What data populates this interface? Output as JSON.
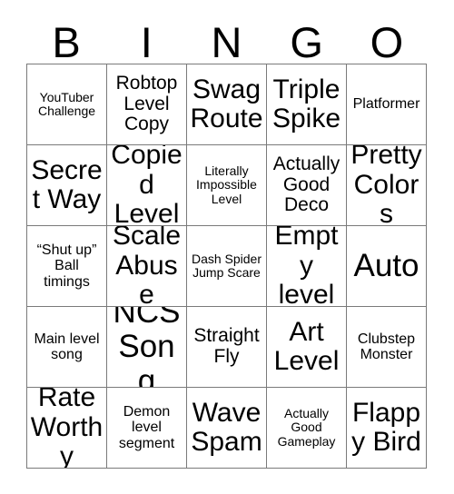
{
  "card": {
    "header_letters": [
      "B",
      "I",
      "N",
      "G",
      "O"
    ],
    "rows": [
      [
        {
          "text": "YouTuber Challenge",
          "size": "xs"
        },
        {
          "text": "Robtop Level Copy",
          "size": "md"
        },
        {
          "text": "Swag Route",
          "size": "xl"
        },
        {
          "text": "Triple Spike",
          "size": "xl"
        },
        {
          "text": "Platformer",
          "size": "sm"
        }
      ],
      [
        {
          "text": "Secret Way",
          "size": "xl"
        },
        {
          "text": "Copied Level",
          "size": "xl"
        },
        {
          "text": "Literally Impossible Level",
          "size": "xs"
        },
        {
          "text": "Actually Good Deco",
          "size": "md"
        },
        {
          "text": "Pretty Colors",
          "size": "xl"
        }
      ],
      [
        {
          "text": "“Shut up” Ball timings",
          "size": "sm"
        },
        {
          "text": "Scale Abuse",
          "size": "xl"
        },
        {
          "text": "Dash Spider Jump Scare",
          "size": "xs"
        },
        {
          "text": "Empty level",
          "size": "xl"
        },
        {
          "text": "Auto",
          "size": "xxl"
        }
      ],
      [
        {
          "text": "Main level song",
          "size": "sm"
        },
        {
          "text": "NCS Song",
          "size": "xxl"
        },
        {
          "text": "Straight Fly",
          "size": "md"
        },
        {
          "text": "Art Level",
          "size": "xl"
        },
        {
          "text": "Clubstep Monster",
          "size": "sm"
        }
      ],
      [
        {
          "text": "Rate Worthy",
          "size": "xl"
        },
        {
          "text": "Demon level segment",
          "size": "sm"
        },
        {
          "text": "Wave Spam",
          "size": "xl"
        },
        {
          "text": "Actually Good Gameplay",
          "size": "xs"
        },
        {
          "text": "Flappy Bird",
          "size": "xl"
        }
      ]
    ]
  },
  "colors": {
    "background": "#ffffff",
    "text": "#000000",
    "grid_line": "#7a7a7a"
  }
}
